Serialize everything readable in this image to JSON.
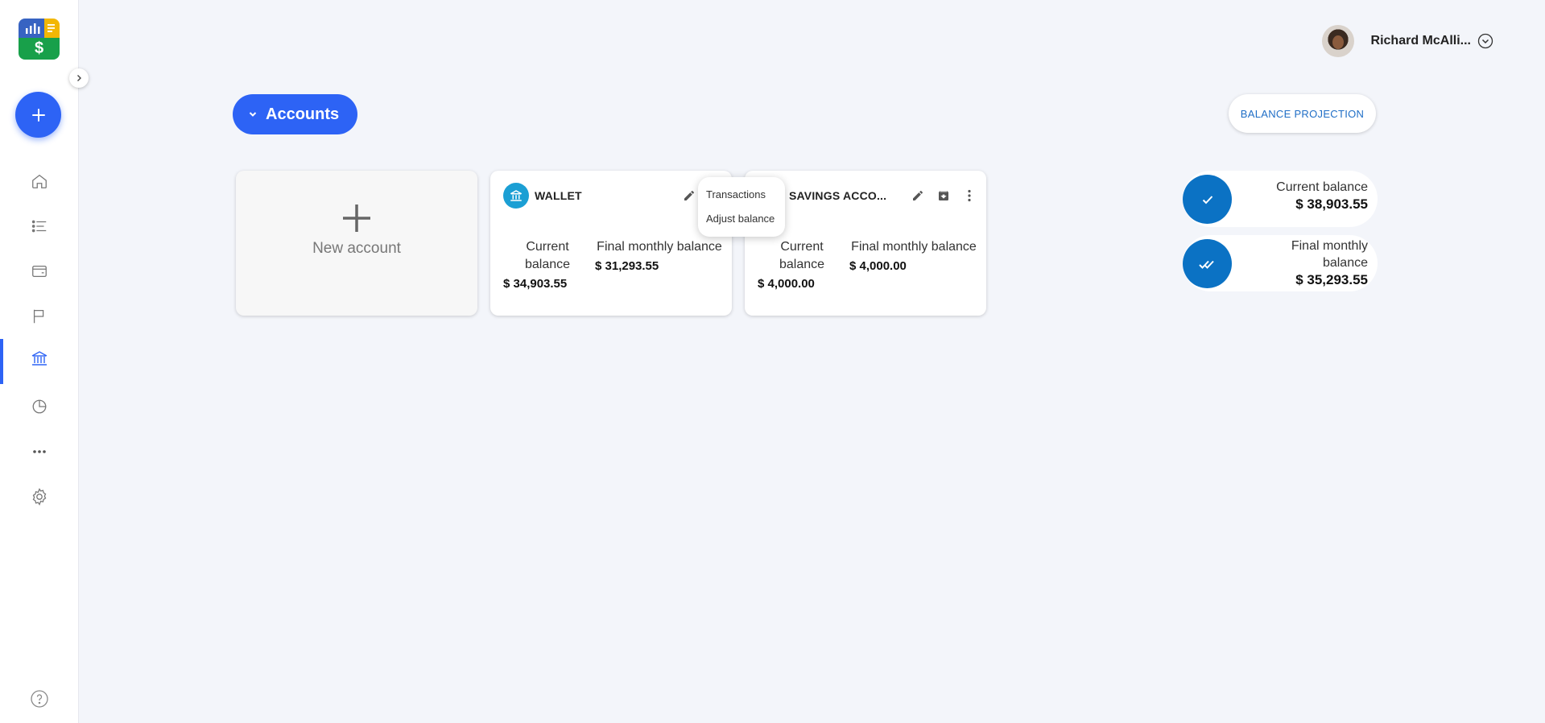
{
  "sidebar": {
    "logo_symbol": "$",
    "nav": [
      {
        "icon": "home-icon"
      },
      {
        "icon": "list-icon"
      },
      {
        "icon": "wallet-icon"
      },
      {
        "icon": "flag-icon"
      },
      {
        "icon": "bank-icon",
        "active": true
      },
      {
        "icon": "pie-chart-icon"
      },
      {
        "icon": "more-icon"
      },
      {
        "icon": "gear-icon"
      }
    ]
  },
  "header": {
    "user_name": "Richard McAlli..."
  },
  "page": {
    "accounts_label": "Accounts",
    "projection_label": "BALANCE PROJECTION"
  },
  "new_account": {
    "label": "New account"
  },
  "accounts": [
    {
      "name": "WALLET",
      "current_label": "Current balance",
      "final_label": "Final monthly balance",
      "current_value": "$ 34,903.55",
      "final_value": "$ 31,293.55"
    },
    {
      "name": "SAVINGS ACCO...",
      "current_label": "Current balance",
      "final_label": "Final monthly balance",
      "current_value": "$ 4,000.00",
      "final_value": "$ 4,000.00"
    }
  ],
  "menu": {
    "items": [
      "Transactions",
      "Adjust balance"
    ]
  },
  "summary": {
    "current": {
      "label": "Current balance",
      "value": "$ 38,903.55"
    },
    "final": {
      "label_line1": "Final monthly",
      "label_line2": "balance",
      "value": "$ 35,293.55"
    }
  },
  "colors": {
    "primary": "#2d63f5",
    "summary_circle": "#0b72c4",
    "bank_badge": "#1b9fd4",
    "projection_text": "#1f6ec6",
    "background": "#f3f5fa"
  }
}
